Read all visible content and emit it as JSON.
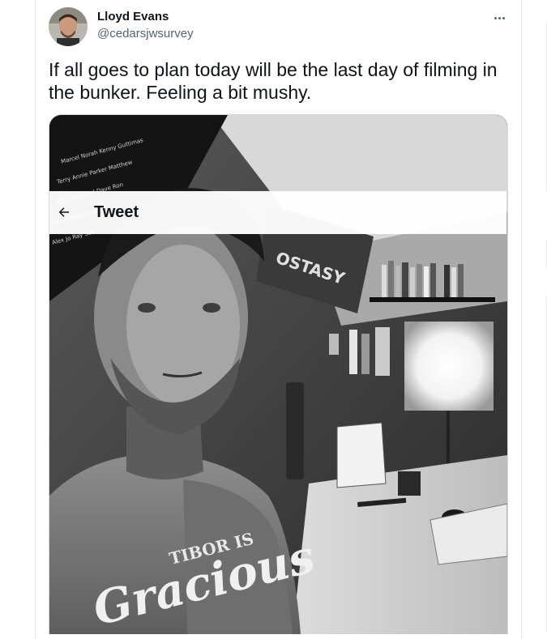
{
  "tweet": {
    "author_name": "Lloyd Evans",
    "author_handle": "@cedarsjwsurvey",
    "text": "If all goes to plan today will be the last day of filming in the bunker. Feeling a bit mushy."
  },
  "overlay_header": {
    "title": "Tweet"
  },
  "photo": {
    "poster_text": "OSTASY",
    "shirt_line1": "TIBOR IS",
    "shirt_line2": "Gracious"
  },
  "colors": {
    "text_primary": "#0f1419",
    "text_secondary": "#536471",
    "border": "#cfd9de"
  },
  "icons": {
    "back": "arrow-left-icon",
    "more": "more-horizontal-icon"
  }
}
